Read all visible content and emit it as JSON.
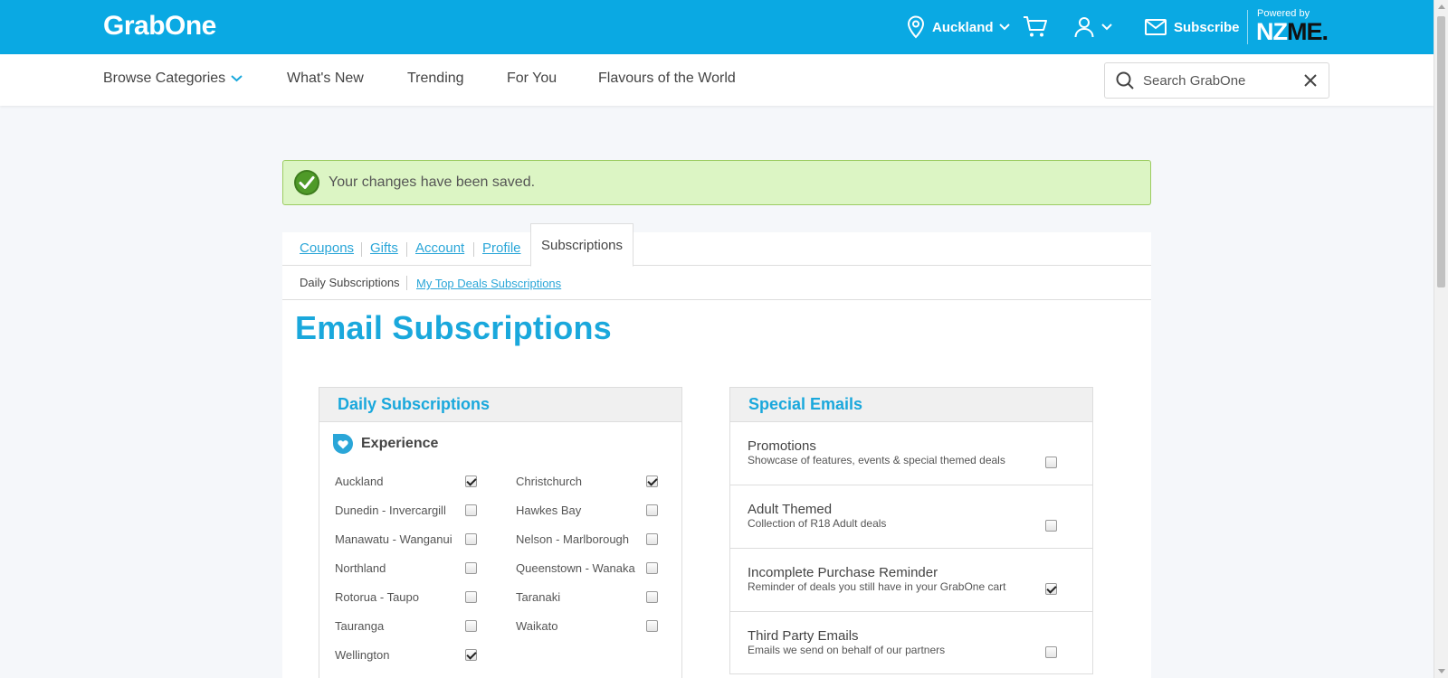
{
  "header": {
    "logo": "GrabOne",
    "location": "Auckland",
    "subscribe_label": "Subscribe",
    "powered_by": "Powered by",
    "nzme_prefix": "NZ",
    "nzme_suffix": "ME."
  },
  "nav": {
    "browse": "Browse Categories",
    "whats_new": "What's New",
    "trending": "Trending",
    "for_you": "For You",
    "flavours": "Flavours of the World",
    "search_placeholder": "Search GrabOne"
  },
  "message": {
    "text": "Your changes have been saved."
  },
  "tabs": {
    "coupons": "Coupons",
    "gifts": "Gifts",
    "account": "Account",
    "profile": "Profile",
    "subscriptions": "Subscriptions"
  },
  "subtabs": {
    "daily": "Daily Subscriptions",
    "top_deals": "My Top Deals Subscriptions"
  },
  "page_title": "Email Subscriptions",
  "daily_box": {
    "title": "Daily Subscriptions",
    "section": "Experience",
    "cities": [
      {
        "name": "Auckland",
        "checked": true
      },
      {
        "name": "Christchurch",
        "checked": true
      },
      {
        "name": "Dunedin - Invercargill",
        "checked": false
      },
      {
        "name": "Hawkes Bay",
        "checked": false
      },
      {
        "name": "Manawatu - Wanganui",
        "checked": false
      },
      {
        "name": "Nelson - Marlborough",
        "checked": false
      },
      {
        "name": "Northland",
        "checked": false
      },
      {
        "name": "Queenstown - Wanaka",
        "checked": false
      },
      {
        "name": "Rotorua - Taupo",
        "checked": false
      },
      {
        "name": "Taranaki",
        "checked": false
      },
      {
        "name": "Tauranga",
        "checked": false
      },
      {
        "name": "Waikato",
        "checked": false
      },
      {
        "name": "Wellington",
        "checked": true
      }
    ]
  },
  "special_box": {
    "title": "Special Emails",
    "items": [
      {
        "title": "Promotions",
        "desc": "Showcase of features, events & special themed deals",
        "checked": false
      },
      {
        "title": "Adult Themed",
        "desc": "Collection of R18 Adult deals",
        "checked": false
      },
      {
        "title": "Incomplete Purchase Reminder",
        "desc": "Reminder of deals you still have in your GrabOne cart",
        "checked": true
      },
      {
        "title": "Third Party Emails",
        "desc": "Emails we send on behalf of our partners",
        "checked": false
      }
    ]
  },
  "colors": {
    "brand": "#0aa9e3",
    "heading": "#1aa8dc",
    "link": "#2aa6d8",
    "success_bg": "#dcf5c4",
    "success_border": "#9ccc62"
  }
}
